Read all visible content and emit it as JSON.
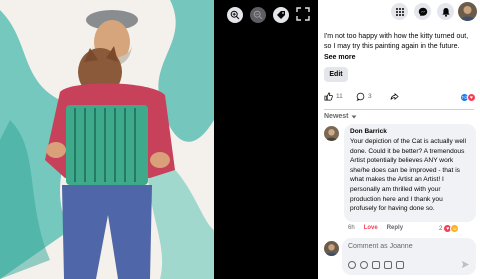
{
  "post": {
    "text": "I'm not too happy with how the kitty turned out, so I may try this painting again in the future.",
    "see_more": "See more",
    "edit_label": "Edit"
  },
  "stats": {
    "likes": "11",
    "comments": "3"
  },
  "comments": {
    "sort_label": "Newest",
    "items": [
      {
        "author": "Don Barrick",
        "text": "Your depiction of the Cat is actually well done. Could it be better? A tremendous Artist potentially believes ANY work she/he does can be improved - that is what makes the Artist an Artist! I personally am thrilled with your production here and I thank you profusely for having done so.",
        "time": "6h",
        "love": "Love",
        "reply": "Reply",
        "reaction_count": "2"
      }
    ]
  },
  "composer": {
    "placeholder": "Comment as Joanne"
  },
  "colors": {
    "accent": "#1877f2",
    "love": "#f33e58",
    "panel_bg": "#ffffff",
    "bubble_bg": "#f0f2f5"
  }
}
